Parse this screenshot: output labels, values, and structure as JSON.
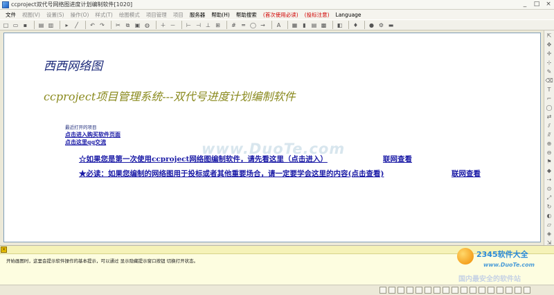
{
  "window": {
    "title": "ccproject双代号网络图进度计划编制软件[1020]"
  },
  "menu": [
    {
      "label": "文件",
      "state": "normal"
    },
    {
      "label": "视图(V)",
      "state": "grey"
    },
    {
      "label": "设置(S)",
      "state": "grey"
    },
    {
      "label": "操作(O)",
      "state": "grey"
    },
    {
      "label": "样式(T)",
      "state": "grey"
    },
    {
      "label": "绘图模式",
      "state": "grey"
    },
    {
      "label": "项目管理",
      "state": "grey"
    },
    {
      "label": "项目",
      "state": "grey"
    },
    {
      "label": "服务器",
      "state": "normal"
    },
    {
      "label": "帮助(H)",
      "state": "normal"
    },
    {
      "label": "帮助搜索",
      "state": "normal"
    },
    {
      "label": "(首次使用必读)",
      "state": "red"
    },
    {
      "label": "(投标注意)",
      "state": "red"
    },
    {
      "label": "Language",
      "state": "normal"
    }
  ],
  "toolbar_icons": [
    "new-file-icon",
    "open-folder-icon",
    "save-icon",
    "sep",
    "print-icon",
    "print-preview-icon",
    "sep",
    "pointer-icon",
    "line-icon",
    "sep",
    "undo-icon",
    "redo-icon",
    "sep",
    "cut-icon",
    "copy-icon",
    "paste-icon",
    "find-icon",
    "sep",
    "zoom-in-icon",
    "zoom-out-icon",
    "sep",
    "align-left-icon",
    "align-center-icon",
    "align-right-icon",
    "distribute-icon",
    "sep",
    "grid-icon",
    "ruler-icon",
    "node-icon",
    "arrow-icon",
    "sep",
    "format-icon",
    "sep",
    "calendar-icon",
    "chart-icon",
    "table-icon",
    "resource-icon",
    "sep",
    "layer-icon",
    "sep",
    "pin-icon",
    "sep",
    "info-icon",
    "settings-icon",
    "folder-icon"
  ],
  "toolbar_glyphs": [
    "□",
    "▭",
    "▪",
    "",
    "▤",
    "▥",
    "",
    "▸",
    "╱",
    "",
    "↶",
    "↷",
    "",
    "✂",
    "⧉",
    "▣",
    "◍",
    "",
    "＋",
    "－",
    "",
    "⊢",
    "⊣",
    "⊥",
    "⊞",
    "",
    "#",
    "═",
    "◯",
    "→",
    "",
    "A",
    "",
    "▦",
    "▮",
    "▤",
    "▩",
    "",
    "◧",
    "",
    "♦",
    "",
    "●",
    "⚙",
    "▬"
  ],
  "right_toolbar_icons": [
    "select-icon",
    "hand-icon",
    "move-icon",
    "crosshair-icon",
    "pen-icon",
    "eraser-icon",
    "text-icon",
    "bracket-icon",
    "node-icon",
    "link-icon",
    "split-icon",
    "merge-icon",
    "insert-icon",
    "delete-icon",
    "flag-icon",
    "milestone-icon",
    "dummy-icon",
    "zoom-icon",
    "fit-icon",
    "refresh-icon",
    "lock-icon",
    "layer-icon",
    "color-icon",
    "export-icon"
  ],
  "right_toolbar_glyphs": [
    "⇱",
    "✥",
    "✛",
    "⊹",
    "✎",
    "⌫",
    "T",
    "⌐",
    "◯",
    "⇄",
    "⫽",
    "⫻",
    "⊕",
    "⊖",
    "⚑",
    "◆",
    "⇢",
    "⊙",
    "⤢",
    "↻",
    "◐",
    "▱",
    "◈",
    "⇲"
  ],
  "canvas": {
    "net_title": "西西网络图",
    "system_title": "ccproject项目管理系统---双代号进度计划编制软件",
    "recent_label": "最近打开的项目",
    "link_buy": "点击进入购买软件页面",
    "link_qq": "点击这里qq交流",
    "first_use_link": "☆如果您是第一次使用ccproject网络图编制软件，请先看这里（点击进入）",
    "first_use_online": "联网查看",
    "must_read_link": "★必读：如果您编制的网络图用于投标或者其他重要场合，请一定要学会这里的内容(点击查看)",
    "must_read_online": "联网查看",
    "watermark": "www.DuoTe.com"
  },
  "hint": {
    "text": "开始画图时，这里会提示软件操作的基本提示，可以通过 显示隐藏提示窗口按钮 切换打开状态。"
  },
  "brand": {
    "name": "2345软件大全",
    "url": "www.DuoTe.com",
    "sub": "国内最安全的软件站"
  }
}
